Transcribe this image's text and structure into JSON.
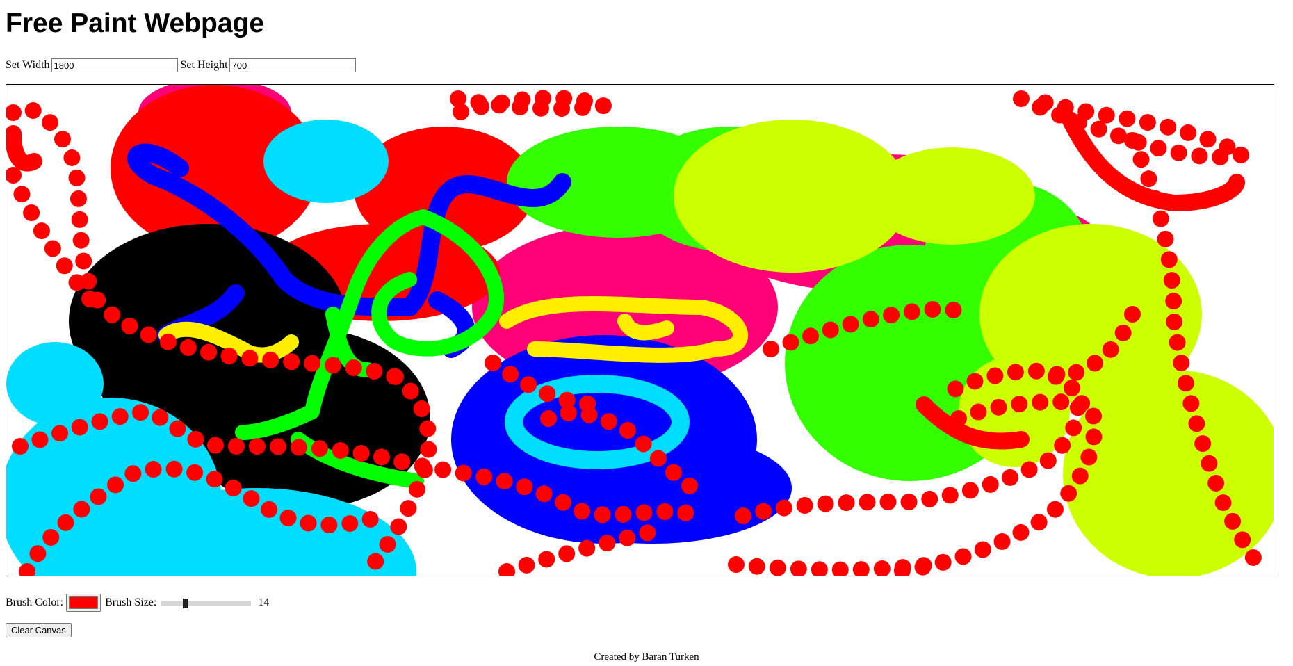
{
  "page": {
    "title": "Free Paint Webpage",
    "footer": "Created by Baran Turken"
  },
  "size_controls": {
    "width_label": "Set Width",
    "width_value": "1800",
    "height_label": "Set Height",
    "height_value": "700"
  },
  "brush": {
    "color_label": "Brush Color:",
    "color_value": "#ff0000",
    "size_label": "Brush Size:",
    "size_value": "14",
    "size_min": 1,
    "size_max": 50,
    "size_number": 14
  },
  "buttons": {
    "clear_label": "Clear Canvas"
  },
  "colors": {
    "red": "#ff0000",
    "black": "#000000",
    "cyan": "#00ddff",
    "blue": "#0000ff",
    "green": "#33ff00",
    "bright_green": "#00ff00",
    "lime": "#ccff00",
    "yellow": "#ffee00",
    "pink": "#ff0077"
  }
}
